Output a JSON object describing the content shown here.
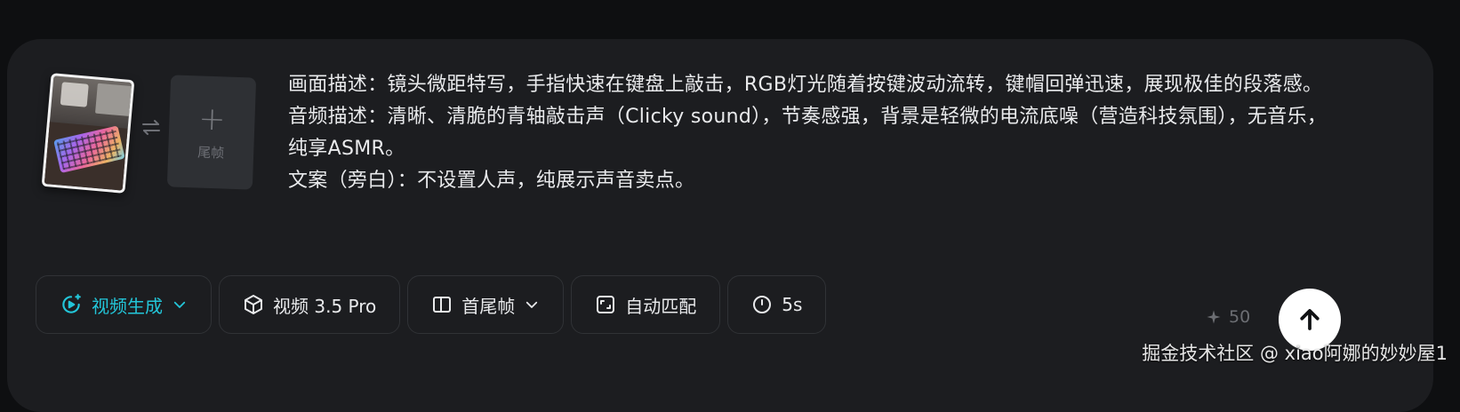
{
  "frames": {
    "end_frame_label": "尾帧",
    "end_frame_plus": "+"
  },
  "prompt": {
    "lines": [
      "画面描述：镜头微距特写，手指快速在键盘上敲击，RGB灯光随着按键波动流转，键帽回弹迅速，展现极佳的段落感。",
      "音频描述：清晰、清脆的青轴敲击声（Clicky sound），节奏感强，背景是轻微的电流底噪（营造科技氛围），无音乐，纯享ASMR。",
      "文案（旁白）：不设置人声，纯展示声音卖点。"
    ]
  },
  "toolbar": {
    "mode_label": "视频生成",
    "model_label": "视频 3.5 Pro",
    "frame_mode_label": "首尾帧",
    "ratio_label": "自动匹配",
    "duration_label": "5s"
  },
  "credits": {
    "value": "50"
  },
  "watermark": {
    "text": "掘金技术社区 @ xiao阿娜的妙妙屋1"
  },
  "colors": {
    "accent": "#23c6d9",
    "panel_bg": "#1c1d20",
    "page_bg": "#0e0f11",
    "text": "#e9eaec"
  },
  "icons": {
    "mode": "video-sparkle-icon",
    "model": "cube-icon",
    "frame_mode": "frame-split-icon",
    "ratio": "aspect-ratio-icon",
    "duration": "clock-icon",
    "credits": "sparkle-icon",
    "send": "arrow-up-icon",
    "swap": "swap-arrows-icon"
  }
}
